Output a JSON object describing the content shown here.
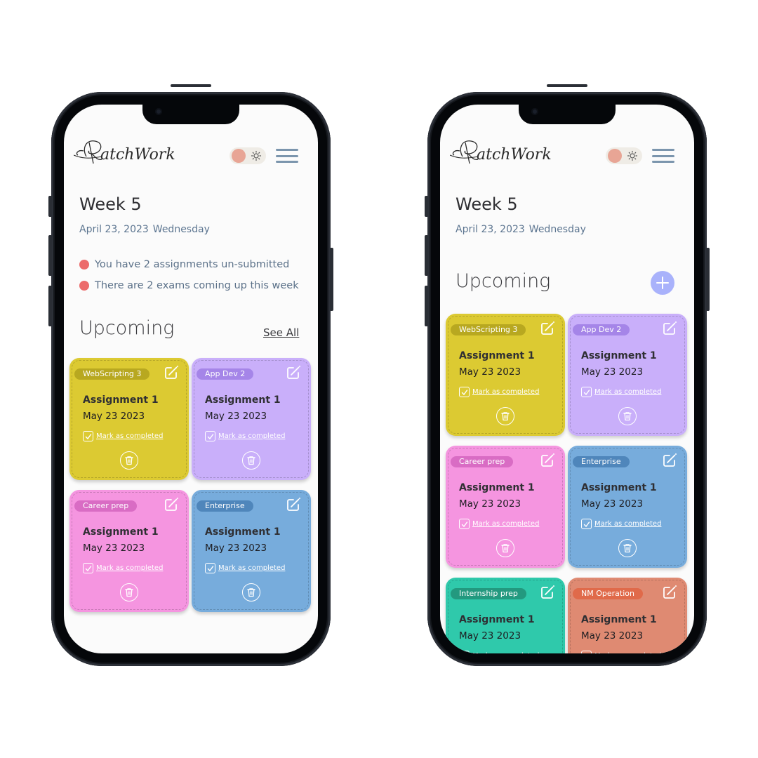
{
  "app": {
    "name": "PatchWork",
    "theme_toggle": {
      "state": "light",
      "knob_color": "#e8a595"
    },
    "menu_icon": "hamburger-menu-icon"
  },
  "colors": {
    "alert_dot": "#ec6b6b",
    "add_button": "#a9b2fb",
    "text_primary": "#2f2f33",
    "text_secondary": "#5c7590"
  },
  "screens": [
    {
      "id": "home",
      "week_title": "Week 5",
      "date": "April 23, 2023",
      "weekday": "Wednesday",
      "alerts": [
        "You have 2 assignments un-submitted",
        "There are 2 exams coming up this week"
      ],
      "section_title": "Upcoming",
      "see_all_label": "See All",
      "cards": [
        {
          "tag": "WebScripting 3",
          "title": "Assignment 1",
          "date": "May 23 2023",
          "action": "Mark as completed",
          "bg": "#dcca32",
          "tag_bg": "#b8a820"
        },
        {
          "tag": "App Dev 2",
          "title": "Assignment 1",
          "date": "May 23 2023",
          "action": "Mark as completed",
          "bg": "#c9affa",
          "tag_bg": "#a585e8"
        },
        {
          "tag": "Career prep",
          "title": "Assignment 1",
          "date": "May 23 2023",
          "action": "Mark as completed",
          "bg": "#f595e0",
          "tag_bg": "#d96cc4"
        },
        {
          "tag": "Enterprise",
          "title": "Assignment 1",
          "date": "May 23 2023",
          "action": "Mark as completed",
          "bg": "#77acdc",
          "tag_bg": "#4f86bb"
        }
      ]
    },
    {
      "id": "upcoming",
      "week_title": "Week 5",
      "date": "April 23, 2023",
      "weekday": "Wednesday",
      "section_title": "Upcoming",
      "add_label": "+",
      "cards": [
        {
          "tag": "WebScripting 3",
          "title": "Assignment 1",
          "date": "May 23 2023",
          "action": "Mark as completed",
          "bg": "#dcca32",
          "tag_bg": "#b8a820"
        },
        {
          "tag": "App Dev 2",
          "title": "Assignment 1",
          "date": "May 23 2023",
          "action": "Mark as completed",
          "bg": "#c9affa",
          "tag_bg": "#a585e8"
        },
        {
          "tag": "Career prep",
          "title": "Assignment 1",
          "date": "May 23 2023",
          "action": "Mark as completed",
          "bg": "#f595e0",
          "tag_bg": "#d96cc4"
        },
        {
          "tag": "Enterprise",
          "title": "Assignment 1",
          "date": "May 23 2023",
          "action": "Mark as completed",
          "bg": "#77acdc",
          "tag_bg": "#4f86bb"
        },
        {
          "tag": "Internship prep",
          "title": "Assignment 1",
          "date": "May 23 2023",
          "action": "Mark as completed",
          "bg": "#2fc9ab",
          "tag_bg": "#23997f"
        },
        {
          "tag": "NM Operation",
          "title": "Assignment 1",
          "date": "May 23 2023",
          "action": "Mark as completed",
          "bg": "#df8a72",
          "tag_bg": "#e06a4a"
        }
      ]
    }
  ]
}
